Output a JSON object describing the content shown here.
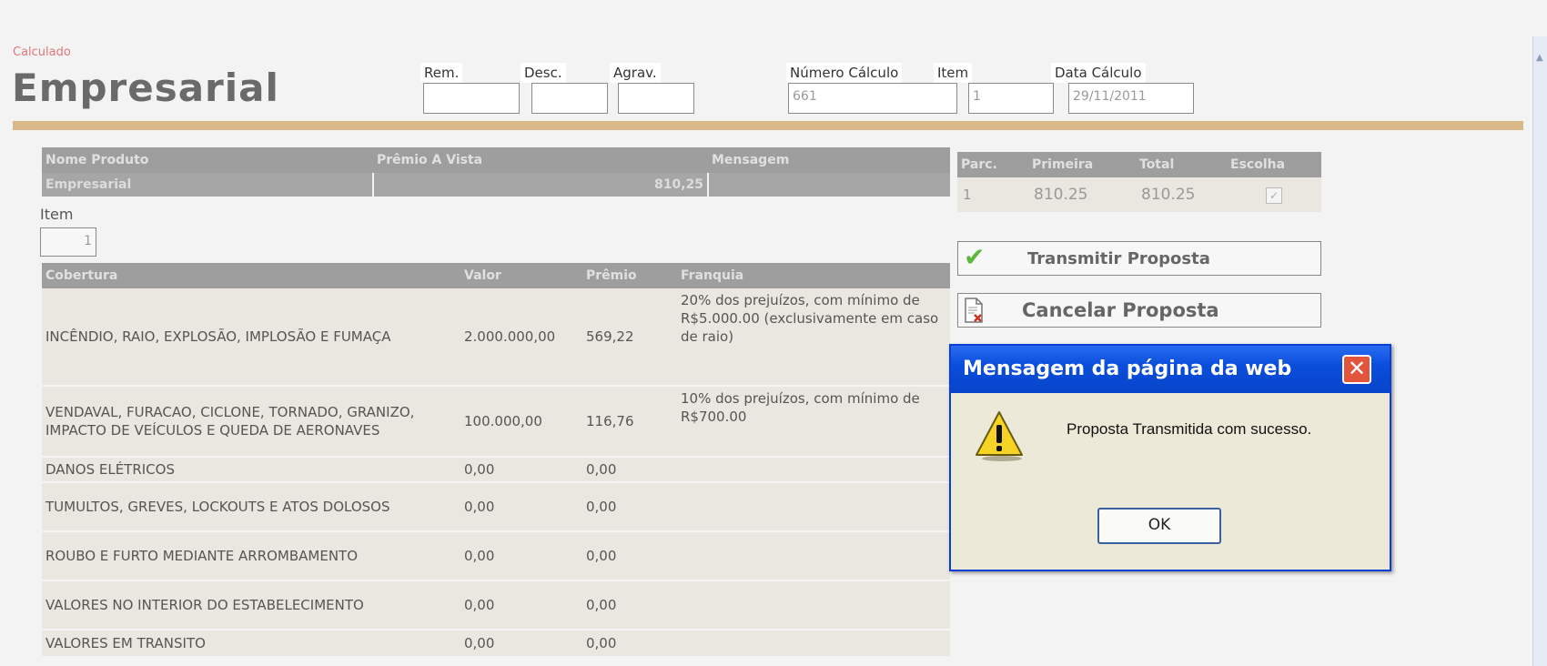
{
  "header": {
    "status": "Calculado",
    "title": "Empresarial",
    "fields": [
      {
        "label": "Rem.",
        "value": ""
      },
      {
        "label": "Desc.",
        "value": ""
      },
      {
        "label": "Agrav.",
        "value": ""
      },
      {
        "label": "Número Cálculo",
        "value": "661"
      },
      {
        "label": "Item",
        "value": "1"
      },
      {
        "label": "Data Cálculo",
        "value": "29/11/2011"
      }
    ]
  },
  "product": {
    "headers": [
      "Nome Produto",
      "Prêmio A Vista",
      "Mensagem"
    ],
    "name": "Empresarial",
    "premium": "810,25",
    "message": ""
  },
  "item": {
    "label": "Item",
    "value": "1"
  },
  "coverage": {
    "headers": [
      "Cobertura",
      "Valor",
      "Prêmio",
      "Franquia"
    ],
    "rows": [
      {
        "cobertura": "INCÊNDIO, RAIO, EXPLOSÃO, IMPLOSÃO E FUMAÇA",
        "valor": "2.000.000,00",
        "premio": "569,22",
        "franquia": "20% dos prejuízos, com mínimo de R$5.000.00 (exclusivamente em caso de raio)"
      },
      {
        "cobertura": "VENDAVAL, FURACAO, CICLONE, TORNADO, GRANIZO, IMPACTO DE VEÍCULOS E QUEDA DE AERONAVES",
        "valor": "100.000,00",
        "premio": "116,76",
        "franquia": "10% dos prejuízos, com mínimo de R$700.00"
      },
      {
        "cobertura": "DANOS ELÉTRICOS",
        "valor": "0,00",
        "premio": "0,00",
        "franquia": ""
      },
      {
        "cobertura": "TUMULTOS, GREVES, LOCKOUTS E ATOS DOLOSOS",
        "valor": "0,00",
        "premio": "0,00",
        "franquia": ""
      },
      {
        "cobertura": "ROUBO E FURTO MEDIANTE ARROMBAMENTO",
        "valor": "0,00",
        "premio": "0,00",
        "franquia": ""
      },
      {
        "cobertura": "VALORES NO INTERIOR DO ESTABELECIMENTO",
        "valor": "0,00",
        "premio": "0,00",
        "franquia": ""
      },
      {
        "cobertura": "VALORES EM TRANSITO",
        "valor": "0,00",
        "premio": "0,00",
        "franquia": ""
      }
    ]
  },
  "installments": {
    "headers": [
      "Parc.",
      "Primeira",
      "Total",
      "Escolha"
    ],
    "rows": [
      {
        "parc": "1",
        "primeira": "810.25",
        "total": "810.25",
        "checked": true
      }
    ]
  },
  "actions": {
    "transmit": "Transmitir Proposta",
    "cancel": "Cancelar Proposta"
  },
  "dialog": {
    "title": "Mensagem da página da web",
    "message": "Proposta Transmitida com sucesso.",
    "ok": "OK"
  },
  "colors": {
    "accent_rule": "#d9b888",
    "table_header": "#9e9e9e",
    "dialog_title": "#0a4edc",
    "close_button": "#e2553c"
  }
}
